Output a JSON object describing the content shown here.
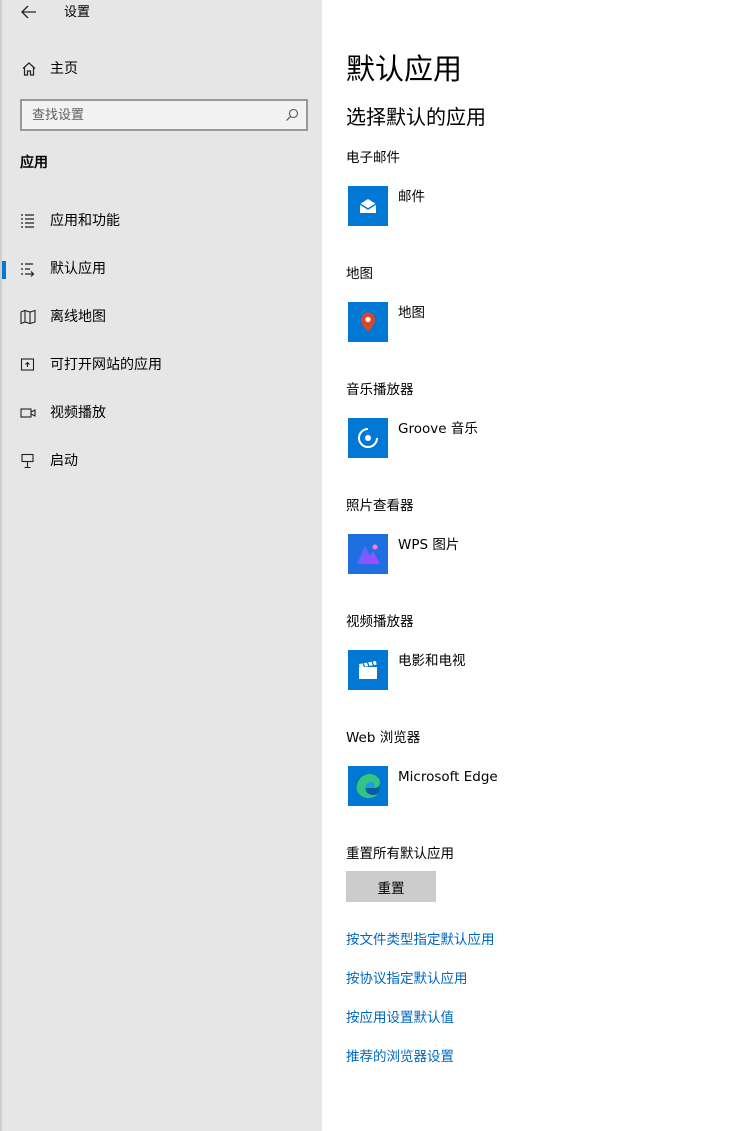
{
  "window": {
    "title": "设置"
  },
  "sidebar": {
    "home_label": "主页",
    "search_placeholder": "查找设置",
    "section_heading": "应用",
    "items": [
      {
        "label": "应用和功能",
        "icon": "apps-list-icon",
        "selected": false
      },
      {
        "label": "默认应用",
        "icon": "default-apps-icon",
        "selected": true
      },
      {
        "label": "离线地图",
        "icon": "offline-map-icon",
        "selected": false
      },
      {
        "label": "可打开网站的应用",
        "icon": "open-website-icon",
        "selected": false
      },
      {
        "label": "视频播放",
        "icon": "video-camera-icon",
        "selected": false
      },
      {
        "label": "启动",
        "icon": "startup-icon",
        "selected": false
      }
    ]
  },
  "main": {
    "title": "默认应用",
    "subtitle": "选择默认的应用",
    "categories": [
      {
        "label": "电子邮件",
        "app": "邮件",
        "icon": "mail-app-icon"
      },
      {
        "label": "地图",
        "app": "地图",
        "icon": "maps-app-icon"
      },
      {
        "label": "音乐播放器",
        "app": "Groove 音乐",
        "icon": "groove-music-icon"
      },
      {
        "label": "照片查看器",
        "app": "WPS 图片",
        "icon": "wps-pictures-icon"
      },
      {
        "label": "视频播放器",
        "app": "电影和电视",
        "icon": "movies-tv-icon"
      },
      {
        "label": "Web 浏览器",
        "app": "Microsoft Edge",
        "icon": "edge-browser-icon"
      }
    ],
    "reset_label": "重置所有默认应用",
    "reset_button": "重置",
    "links": [
      "按文件类型指定默认应用",
      "按协议指定默认应用",
      "按应用设置默认值",
      "推荐的浏览器设置"
    ]
  },
  "colors": {
    "accent": "#0078d4",
    "link": "#0067c0",
    "sidebar_bg": "#e6e6e6",
    "tile_bg": "#0078d4",
    "button_bg": "#cccccc"
  }
}
